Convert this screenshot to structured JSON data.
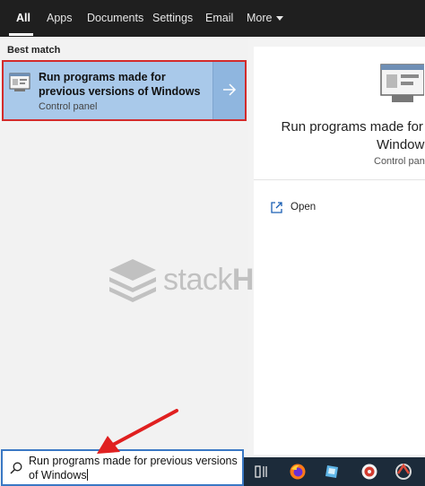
{
  "tabs": [
    {
      "label": "All",
      "active": true
    },
    {
      "label": "Apps",
      "active": false
    },
    {
      "label": "Documents",
      "active": false
    },
    {
      "label": "Settings",
      "active": false
    },
    {
      "label": "Email",
      "active": false
    },
    {
      "label": "More",
      "active": false
    }
  ],
  "results": {
    "section_label": "Best match",
    "best_match": {
      "title": "Run programs made for previous versions of Windows",
      "subtitle": "Control panel",
      "icon": "compatibility-icon"
    }
  },
  "detail": {
    "title_line1": "Run programs made for p",
    "title_line2": "Windows",
    "subtitle": "Control pane",
    "actions": [
      {
        "label": "Open",
        "icon": "open-icon"
      }
    ]
  },
  "search": {
    "value": "Run programs made for previous versions of Windows"
  },
  "watermark": {
    "light": "stack",
    "bold": "HowTo"
  },
  "taskbar": {
    "items": [
      "task-view-icon",
      "firefox-icon",
      "notepad-icon",
      "media-icon",
      "app-icon"
    ]
  },
  "colors": {
    "selected_bg": "#a9c9ea",
    "highlight_border": "#d32b2b",
    "search_border": "#3a78c4",
    "tabbar_bg": "#1f1f1f"
  }
}
